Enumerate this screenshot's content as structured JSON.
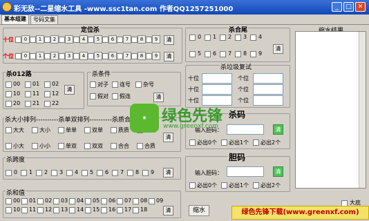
{
  "window": {
    "title": "彩无敌--二星缩水工具 -www.ssc1tan.com 作者QQ1257251000",
    "min": "_",
    "max": "□",
    "close": "✕"
  },
  "tabs": [
    "基本组建",
    "号码文集"
  ],
  "dingwei": {
    "title": "定位杀",
    "rows": [
      {
        "label": "十位"
      },
      {
        "label": "个位"
      }
    ],
    "digits": [
      "0",
      "1",
      "2",
      "3",
      "4",
      "5",
      "6",
      "7",
      "8",
      "9"
    ],
    "clear": "清"
  },
  "shahewei": {
    "title": "杀合尾",
    "digits": [
      "0",
      "1",
      "2",
      "3",
      "4",
      "5",
      "6",
      "7",
      "8",
      "9"
    ],
    "clear": "清"
  },
  "result": {
    "title": "缩水结果"
  },
  "sha012": {
    "title": "杀012路",
    "items": [
      "00",
      "01",
      "02",
      "10",
      "11",
      "12",
      "20",
      "21",
      "22"
    ],
    "clear": "清"
  },
  "shatiao": {
    "title": "杀条件",
    "items": [
      "对子",
      "连号",
      "杂号",
      "假对",
      "假连"
    ],
    "clear": "清"
  },
  "shalaji": {
    "title": "杀垃圾复试",
    "rowlabels": [
      "十位",
      "十位",
      "十位"
    ],
    "collabels": [
      "个位",
      "个位",
      "个位"
    ]
  },
  "daxiao": {
    "title": "杀大小排列----------杀单双排列----------杀质合排列",
    "items": [
      "大大",
      "大小",
      "单单",
      "双单",
      "质质",
      "质合",
      "小大",
      "小小",
      "单双",
      "双双",
      "合合",
      "合质"
    ],
    "clear": "清"
  },
  "yuxia": {
    "title": "杀跨度",
    "digits": [
      "0",
      "1",
      "2",
      "3",
      "4",
      "5",
      "6",
      "7",
      "8",
      "9"
    ],
    "clear": "清"
  },
  "hezhi": {
    "title": "杀和值",
    "items": [
      "00",
      "01",
      "02",
      "03",
      "04",
      "05",
      "06",
      "07",
      "08",
      "09",
      "10",
      "11",
      "12",
      "13",
      "14",
      "15",
      "16",
      "17",
      "18"
    ],
    "clear": "清"
  },
  "shadan": {
    "title": "杀码",
    "input_label": "输入胆码：",
    "go": "清",
    "opts": [
      "必出0个",
      "必出1个",
      "必出2个"
    ]
  },
  "dan": {
    "title": "胆码",
    "input_label": "输入胆码：",
    "go": "清",
    "opts": [
      "必出0个",
      "必出1个",
      "必出2个"
    ]
  },
  "actions": {
    "shrink": "缩水",
    "da": "大底"
  },
  "banner": "绿色先锋下载(www.greenxf.com)",
  "watermark": {
    "brand": "绿色先锋",
    "url": "www.greenxf.com"
  },
  "colors": {
    "title_bar": "#1f5ccc",
    "accent_red": "#e00000",
    "green": "#4fc25a"
  }
}
